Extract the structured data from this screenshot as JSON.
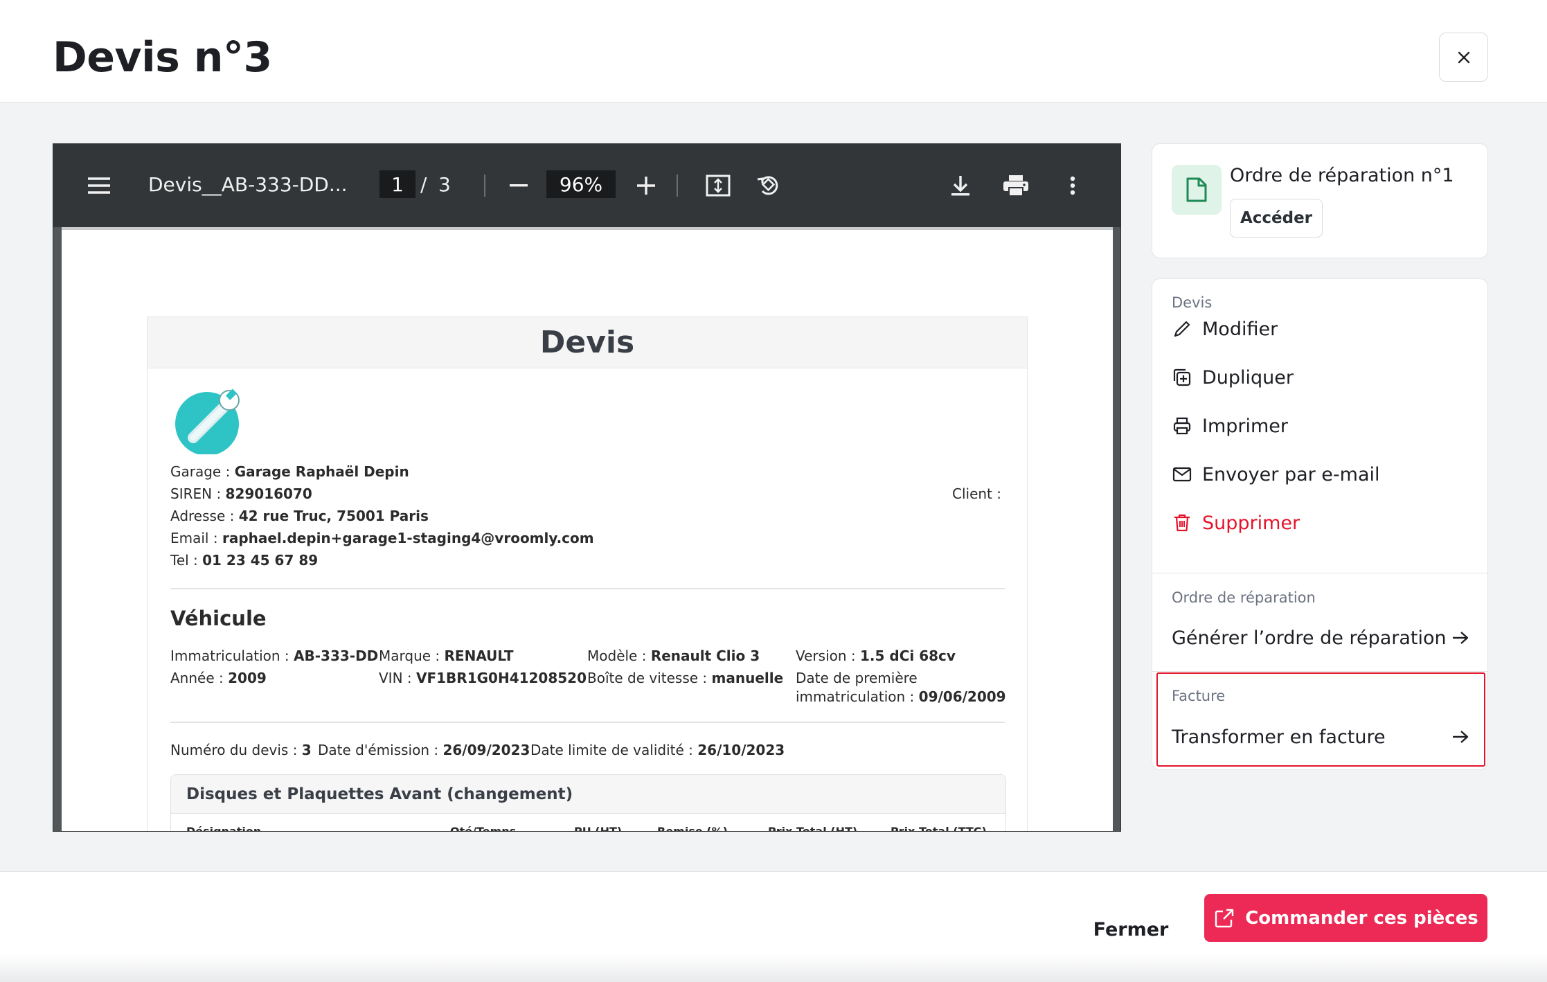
{
  "header": {
    "title": "Devis n°3",
    "close_icon": "close-icon"
  },
  "viewer": {
    "filename": "Devis__AB-333-DD...",
    "current_page": "1",
    "page_separator": "/",
    "total_pages": "3",
    "zoom": "96%",
    "icons": [
      "menu-icon",
      "zoom-out-icon",
      "zoom-in-icon",
      "fit-page-icon",
      "rotate-icon",
      "download-icon",
      "print-icon",
      "more-icon"
    ]
  },
  "document": {
    "title": "Devis",
    "garage": {
      "label": "Garage : ",
      "value": "Garage Raphaël Depin"
    },
    "siren": {
      "label": "SIREN : ",
      "value": "829016070"
    },
    "address": {
      "label": "Adresse : ",
      "value": "42 rue Truc, 75001 Paris"
    },
    "email": {
      "label": "Email : ",
      "value": "raphael.depin+garage1-staging4@vroomly.com"
    },
    "tel": {
      "label": "Tel : ",
      "value": "01 23 45 67 89"
    },
    "client_label": "Client :",
    "vehicle_title": "Véhicule",
    "immat": {
      "label": "Immatriculation : ",
      "value": "AB-333-DD"
    },
    "marque": {
      "label": "Marque : ",
      "value": "RENAULT"
    },
    "modele": {
      "label": "Modèle : ",
      "value": "Renault Clio 3"
    },
    "version": {
      "label": "Version : ",
      "value": "1.5 dCi 68cv"
    },
    "annee": {
      "label": "Année : ",
      "value": "2009"
    },
    "vin": {
      "label": "VIN : ",
      "value": "VF1BR1G0H41208520"
    },
    "boite": {
      "label": "Boîte de vitesse : ",
      "value": "manuelle"
    },
    "date_immat_line1": "Date de première",
    "date_immat": {
      "label": "immatriculation : ",
      "value": "09/06/2009"
    },
    "numero": {
      "label": "Numéro du devis : ",
      "value": "3"
    },
    "emission": {
      "label": "Date d'émission : ",
      "value": "26/09/2023"
    },
    "validite": {
      "label": "Date limite de validité : ",
      "value": "26/10/2023"
    },
    "section_title": "Disques et Plaquettes Avant (changement)",
    "columns": [
      "Désignation",
      "Qté/Temps",
      "PU (HT)",
      "Remise (%)",
      "Prix Total (HT)",
      "Prix Total (TTC)"
    ]
  },
  "side": {
    "repair_order": {
      "title": "Ordre de réparation n°1",
      "button": "Accéder"
    },
    "devis_section": {
      "label": "Devis",
      "actions": [
        "Modifier",
        "Dupliquer",
        "Imprimer",
        "Envoyer par e-mail",
        "Supprimer"
      ]
    },
    "or_section": {
      "label": "Ordre de réparation",
      "action": "Générer l’ordre de réparation"
    },
    "facture_section": {
      "label": "Facture",
      "action": "Transformer en facture"
    }
  },
  "footer": {
    "close_label": "Fermer",
    "order_label": "Commander ces pièces"
  },
  "colors": {
    "accent": "#ec2a55",
    "danger": "#e3152b",
    "toolbar": "#323639"
  }
}
